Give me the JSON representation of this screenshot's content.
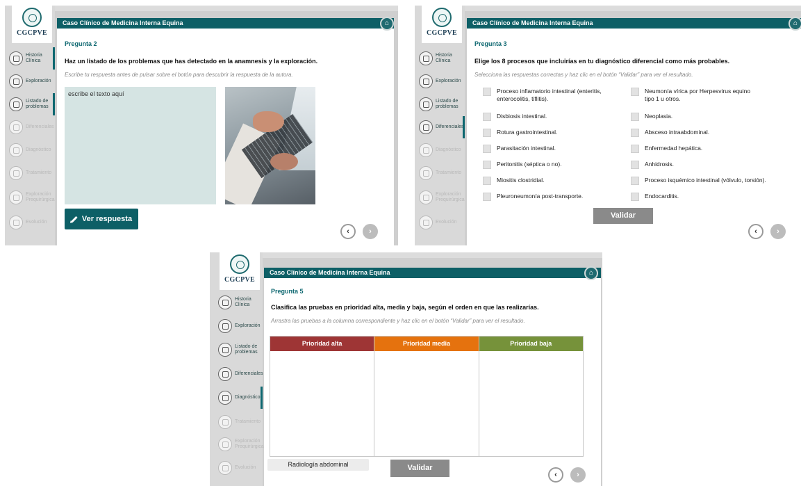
{
  "app": {
    "logo_text": "CGCPVE",
    "title": "Caso Clínico de Medicina Interna Equina",
    "home_icon": "home-icon"
  },
  "colors": {
    "teal": "#0d5f66",
    "high": "#9e3535",
    "medium": "#e5720e",
    "low": "#76923a"
  },
  "nav_items": [
    {
      "id": "historia",
      "label": "Historia Clínica",
      "icon": "clipboard-icon"
    },
    {
      "id": "exploracion",
      "label": "Exploración",
      "icon": "stethoscope-icon"
    },
    {
      "id": "listado",
      "label": "Listado de problemas",
      "icon": "list-icon"
    },
    {
      "id": "diferenciales",
      "label": "Diferenciales",
      "icon": "book-icon"
    },
    {
      "id": "diagnostico",
      "label": "Diagnóstico",
      "icon": "microscope-icon"
    },
    {
      "id": "tratamiento",
      "label": "Tratamiento",
      "icon": "syringe-icon"
    },
    {
      "id": "exploracion-prequirurgica",
      "label": "Exploración Prequirúrgica",
      "icon": "horse-icon"
    },
    {
      "id": "evolucion",
      "label": "Evolución",
      "icon": "calendar-icon"
    }
  ],
  "panels": [
    {
      "question_number": "Pregunta 2",
      "question": "Haz un listado de los problemas que has detectado en la anamnesis y la exploración.",
      "hint": "Escribe tu respuesta antes de pulsar sobre el botón para descubrir la respuesta de la autora.",
      "textarea_value": "escribe el texto aquí",
      "button_label": "Ver respuesta"
    },
    {
      "question_number": "Pregunta 3",
      "question": "Elige los 8 procesos que incluirías en tu diagnóstico diferencial como más probables.",
      "hint": "Selecciona las respuestas correctas y haz clic en el botón “Validar” para ver el resultado.",
      "options_left": [
        "Proceso inflamatorio intestinal (enteritis, enterocolitis, tiflitis).",
        "Disbiosis intestinal.",
        "Rotura gastrointestinal.",
        "Parasitación intestinal.",
        "Peritonitis (séptica o no).",
        "Miositis clostridial.",
        "Pleuroneumonía post-transporte."
      ],
      "options_right": [
        "Neumonía vírica por Herpesvirus equino tipo 1 u otros.",
        "Neoplasia.",
        "Absceso intraabdominal.",
        "Enfermedad hepática.",
        "Anhidrosis.",
        "Proceso isquémico intestinal (vólvulo, torsión).",
        "Endocarditis."
      ],
      "button_label": "Validar"
    },
    {
      "question_number": "Pregunta 5",
      "question": "Clasifica las pruebas en prioridad alta, media y baja, según el orden en que las realizarías.",
      "hint": "Arrastra las pruebas a la columna correspondiente y haz clic en el botón “Validar” para ver el resultado.",
      "columns": [
        "Prioridad alta",
        "Prioridad media",
        "Prioridad baja"
      ],
      "draggable_item": "Radiología abdominal",
      "button_label": "Validar"
    }
  ]
}
